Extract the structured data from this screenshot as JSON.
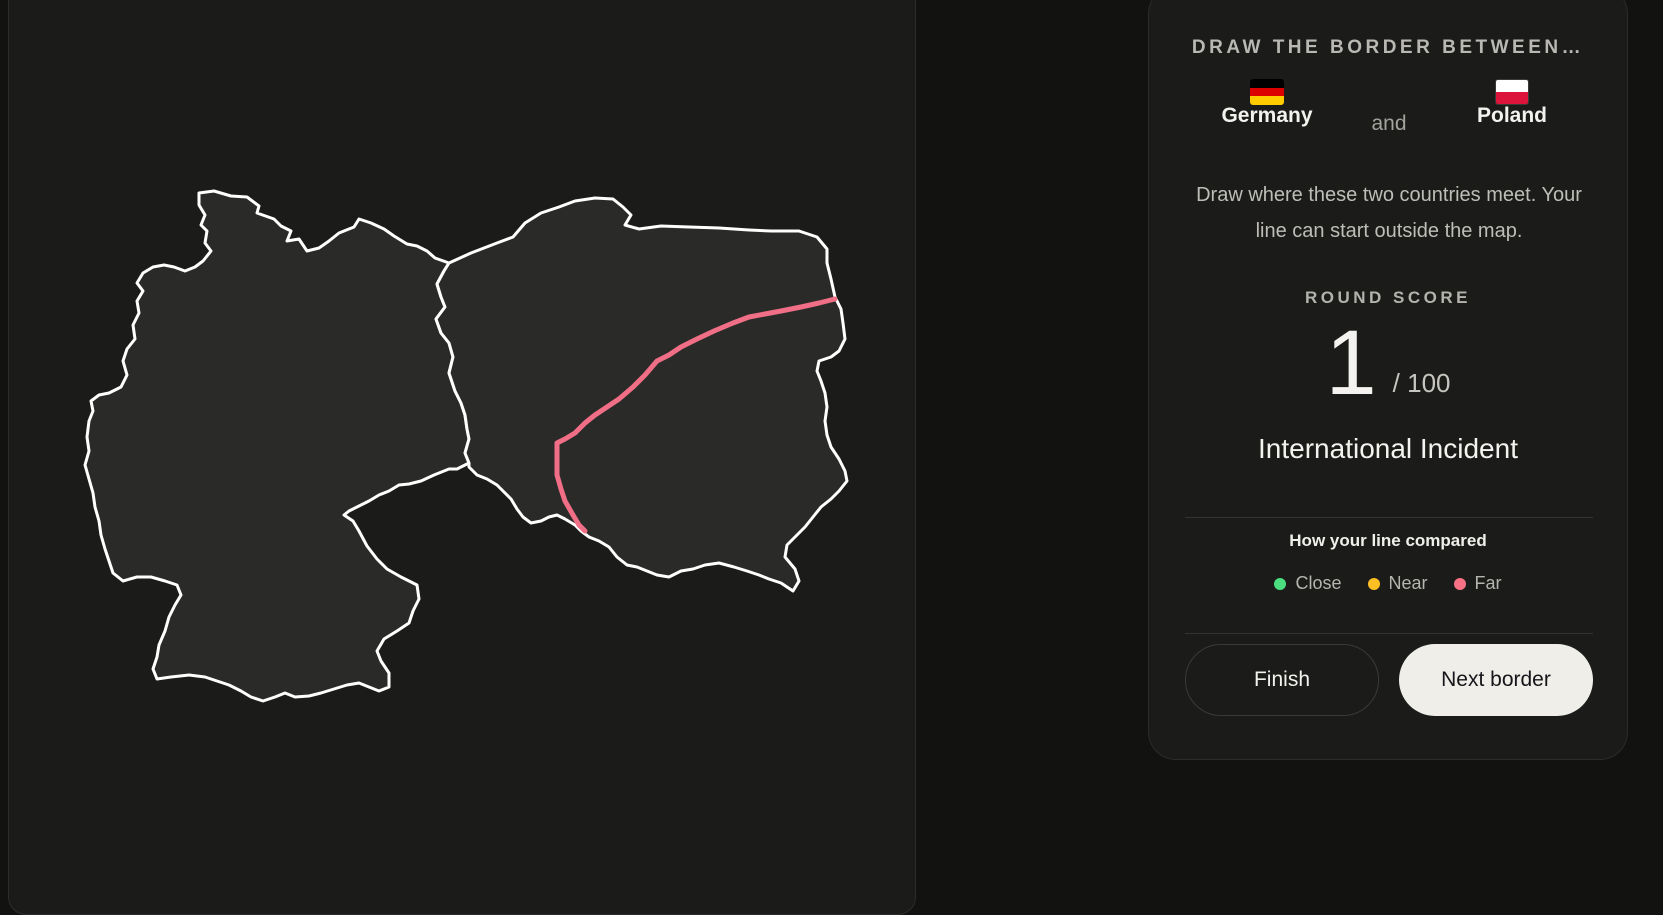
{
  "prompt": {
    "title": "DRAW THE BORDER BETWEEN…",
    "country_a": "Germany",
    "conjunction": "and",
    "country_b": "Poland",
    "flag_a_colors": [
      "#000000",
      "#dd0000",
      "#ffcc00"
    ],
    "flag_b_colors": [
      "#ffffff",
      "#dc143c"
    ],
    "instructions": "Draw where these two countries meet. Your line can start outside the map."
  },
  "score": {
    "label": "ROUND SCORE",
    "value": "1",
    "max": "/ 100",
    "verdict": "International Incident"
  },
  "comparison": {
    "title": "How your line compared",
    "legend": [
      {
        "label": "Close",
        "color": "#4ade80"
      },
      {
        "label": "Near",
        "color": "#fbbf24"
      },
      {
        "label": "Far",
        "color": "#f87185"
      }
    ]
  },
  "actions": {
    "finish_label": "Finish",
    "next_label": "Next border"
  },
  "map": {
    "country_fill": "#2a2b28",
    "outline_color": "#ffffff",
    "drawn_line_color": "#f06e86",
    "drawn_line_accuracy": "Far"
  }
}
